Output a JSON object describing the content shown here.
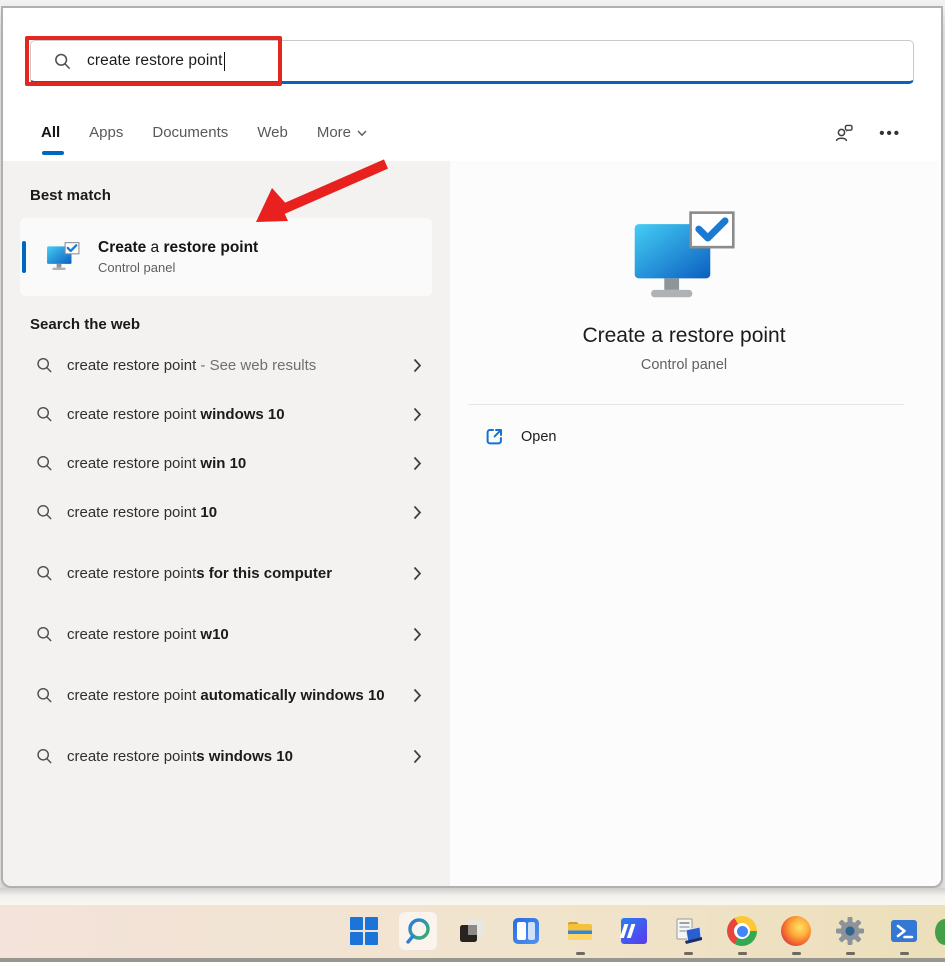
{
  "window": {
    "search_box": {
      "value": "create restore point"
    },
    "tabs": {
      "items": [
        {
          "label": "All",
          "active": true
        },
        {
          "label": "Apps",
          "active": false
        },
        {
          "label": "Documents",
          "active": false
        },
        {
          "label": "Web",
          "active": false
        },
        {
          "label": "More",
          "active": false,
          "has_chevron": true
        }
      ],
      "ellipsis": "•••"
    },
    "best_match": {
      "header": "Best match",
      "item": {
        "title_bold_1": "Create",
        "title_normal": " a ",
        "title_bold_2": "restore point",
        "subtitle": "Control panel"
      }
    },
    "web_search": {
      "header": "Search the web",
      "suggestions": [
        {
          "normal": "create restore point",
          "bold": "",
          "suffix": " - See web results"
        },
        {
          "normal": "create restore point ",
          "bold": "windows 10",
          "suffix": ""
        },
        {
          "normal": "create restore point ",
          "bold": "win 10",
          "suffix": ""
        },
        {
          "normal": "create restore point ",
          "bold": "10",
          "suffix": ""
        },
        {
          "normal": "create restore point",
          "bold": "s for this computer",
          "suffix": ""
        },
        {
          "normal": "create restore point ",
          "bold": "w10",
          "suffix": ""
        },
        {
          "normal": "create restore point ",
          "bold": "automatically windows 10",
          "suffix": ""
        },
        {
          "normal": "create restore point",
          "bold": "s windows 10",
          "suffix": ""
        }
      ]
    },
    "preview": {
      "title": "Create a restore point",
      "subtitle": "Control panel",
      "open_label": "Open"
    }
  },
  "annotations": {
    "red_box_color": "#e22620",
    "arrow_color": "#e8201e"
  },
  "colors": {
    "accent_blue": "#0067c0",
    "search_underline": "#0b63b8",
    "left_panel_bg": "#f3f2f0",
    "taskbar_gradient_left": "#f3e3da",
    "taskbar_gradient_right": "#ecdfba"
  },
  "taskbar": {
    "items": [
      {
        "icon": "windows-start-icon",
        "active": false,
        "running": false
      },
      {
        "icon": "search-icon",
        "active": true,
        "running": false
      },
      {
        "icon": "task-view-icon",
        "active": false,
        "running": false
      },
      {
        "icon": "widgets-icon",
        "active": false,
        "running": false
      },
      {
        "icon": "file-explorer-icon",
        "active": false,
        "running": true
      },
      {
        "icon": "media-app-icon",
        "active": false,
        "running": false
      },
      {
        "icon": "system-properties-icon",
        "active": false,
        "running": true
      },
      {
        "icon": "chrome-icon",
        "active": false,
        "running": true
      },
      {
        "icon": "firefox-icon",
        "active": false,
        "running": true
      },
      {
        "icon": "settings-gear-icon",
        "active": false,
        "running": true
      },
      {
        "icon": "powershell-icon",
        "active": false,
        "running": true
      }
    ]
  }
}
